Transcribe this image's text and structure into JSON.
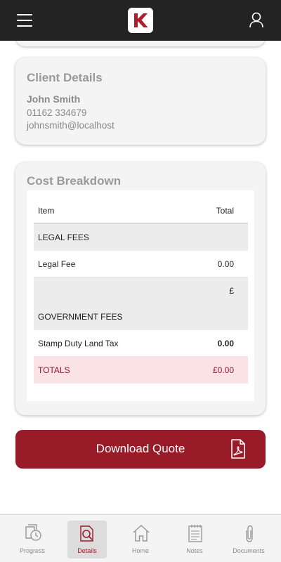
{
  "header": {
    "logo_icon": "k-logo-icon",
    "menu_icon": "hamburger-menu-icon",
    "profile_icon": "user-profile-icon"
  },
  "client_details": {
    "title": "Client Details",
    "name": "John Smith",
    "phone": "01162 334679",
    "email": "johnsmith@localhost"
  },
  "cost_breakdown": {
    "title": "Cost Breakdown",
    "headers": {
      "item": "Item",
      "total": "Total"
    },
    "legal_section": "LEGAL FEES",
    "legal_fee": {
      "label": "Legal Fee",
      "value": "0.00"
    },
    "legal_subtotal": "£",
    "government_section": "GOVERNMENT FEES",
    "stamp_duty": {
      "label": "Stamp Duty Land Tax",
      "value": "0.00"
    },
    "totals": {
      "label": "TOTALS",
      "value": "£0.00"
    }
  },
  "download_button": {
    "label": "Download Quote",
    "icon": "pdf-file-icon"
  },
  "bottom_nav": {
    "active": "Details",
    "active_color": "#9a1b28",
    "items": [
      {
        "label": "Progress",
        "icon": "progress-clock-icon"
      },
      {
        "label": "Details",
        "icon": "details-search-icon"
      },
      {
        "label": "Home",
        "icon": "home-icon"
      },
      {
        "label": "Notes",
        "icon": "notes-icon"
      },
      {
        "label": "Documents",
        "icon": "paperclip-icon"
      }
    ]
  },
  "colors": {
    "brand": "#9a1b28",
    "topbar": "#232323",
    "totals_bg": "#fbe2e4"
  }
}
